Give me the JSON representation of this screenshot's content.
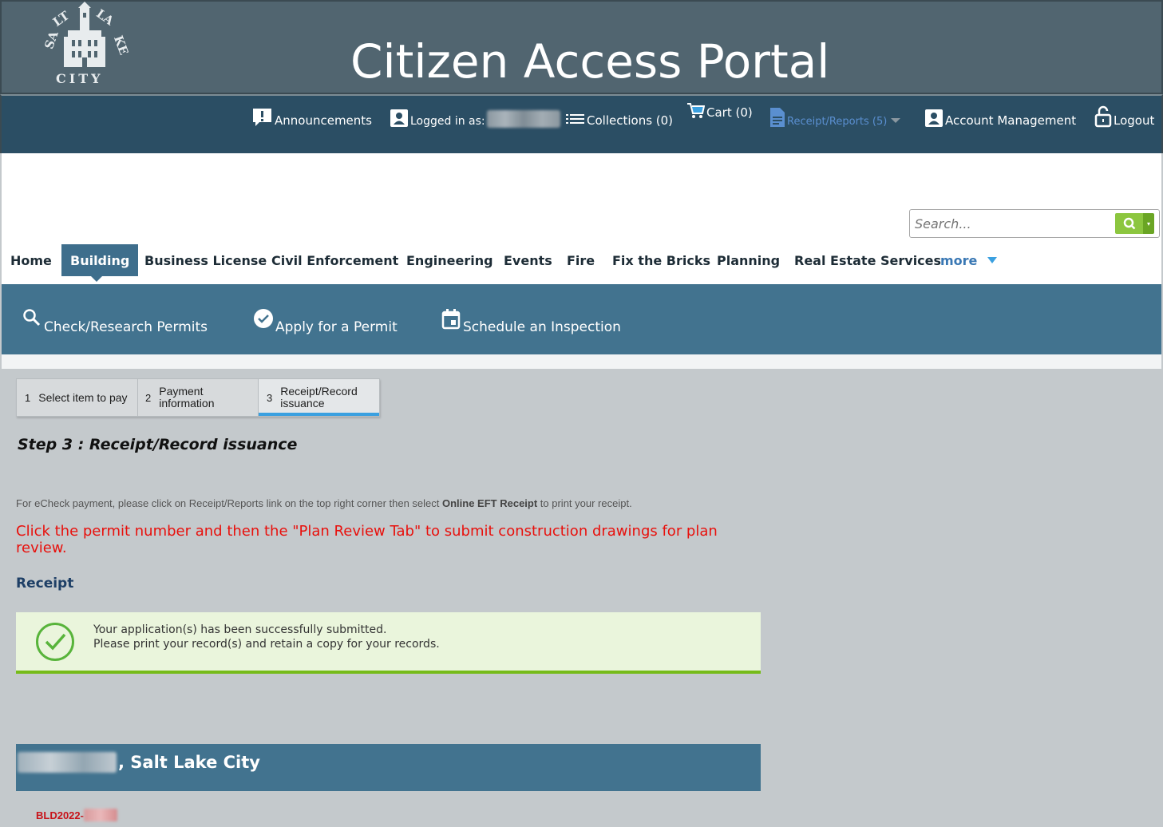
{
  "header": {
    "logo_text": "SALT LAKE CITY",
    "title": "Citizen Access Portal"
  },
  "topnav": {
    "announcements": "Announcements",
    "logged_in": "Logged in as:",
    "collections": "Collections (0)",
    "cart": "Cart (0)",
    "receipt_reports": "Receipt/Reports (5)",
    "account_management": "Account Management",
    "logout": "Logout"
  },
  "search": {
    "placeholder": "Search..."
  },
  "module_tabs": [
    {
      "label": "Home"
    },
    {
      "label": "Building"
    },
    {
      "label": "Business License"
    },
    {
      "label": "Civil Enforcement"
    },
    {
      "label": "Engineering"
    },
    {
      "label": "Events"
    },
    {
      "label": "Fire"
    },
    {
      "label": "Fix the Bricks"
    },
    {
      "label": "Planning"
    },
    {
      "label": "Real Estate Services"
    },
    {
      "label": "more"
    }
  ],
  "actions": {
    "check_research": "Check/Research Permits",
    "apply": "Apply for a Permit",
    "schedule": "Schedule an Inspection"
  },
  "steps": [
    {
      "num": "1",
      "label": "Select item to pay"
    },
    {
      "num": "2",
      "label_line1": "Payment",
      "label_line2": "information"
    },
    {
      "num": "3",
      "label_line1": "Receipt/Record",
      "label_line2": "issuance"
    }
  ],
  "step_title": "Step 3 : Receipt/Record issuance",
  "echeck": {
    "prefix": "For eCheck payment, please click on Receipt/Reports link on the top right corner then select ",
    "bold": "Online EFT Receipt",
    "suffix": " to print your receipt."
  },
  "red_message": "Click the permit number and then the \"Plan Review Tab\" to submit construction drawings for plan review.",
  "receipt_label": "Receipt",
  "success": {
    "line1": "Your application(s) has been successfully submitted.",
    "line2": "Please print your record(s) and retain a copy for your records."
  },
  "record": {
    "city": ", Salt Lake City",
    "number_prefix": "BLD2022-"
  },
  "colors": {
    "banner": "#516570",
    "topnav": "#2b4e64",
    "accent": "#42738f",
    "success_green": "#76bb1a",
    "alert_red": "#e8100c"
  }
}
